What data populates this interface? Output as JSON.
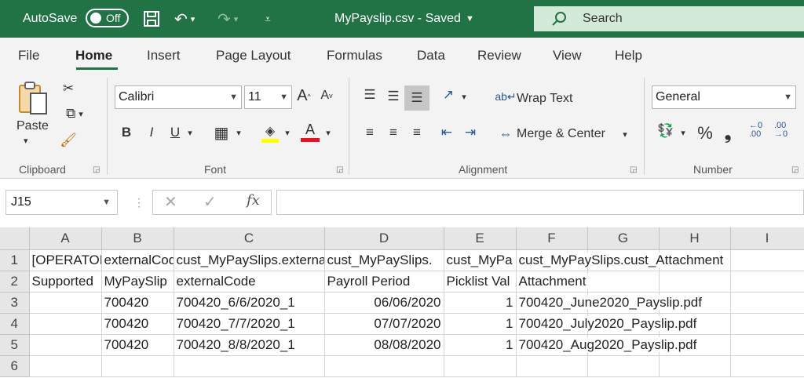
{
  "titlebar": {
    "autosave_label": "AutoSave",
    "autosave_state": "Off",
    "doc_title": "MyPayslip.csv  -  Saved",
    "search_placeholder": "Search"
  },
  "tabs": [
    "File",
    "Home",
    "Insert",
    "Page Layout",
    "Formulas",
    "Data",
    "Review",
    "View",
    "Help"
  ],
  "active_tab": "Home",
  "ribbon": {
    "clipboard": {
      "label": "Clipboard",
      "paste": "Paste"
    },
    "font": {
      "label": "Font",
      "family": "Calibri",
      "size": "11",
      "bold": "B",
      "italic": "I",
      "underline": "U",
      "grow": "A",
      "shrink": "A",
      "font_color_glyph": "A",
      "font_color": "#e81123",
      "highlight_color": "#ffff00"
    },
    "alignment": {
      "label": "Alignment",
      "wrap_text": "Wrap Text",
      "merge_center": "Merge & Center"
    },
    "number": {
      "label": "Number",
      "format": "General",
      "percent": "%",
      "comma": "❟",
      "inc_decimal": "←0 .00",
      "dec_decimal": ".00 →0"
    }
  },
  "formula_bar": {
    "name_box": "J15",
    "fx": "fx",
    "formula": ""
  },
  "grid": {
    "columns": [
      "A",
      "B",
      "C",
      "D",
      "E",
      "F",
      "G",
      "H",
      "I"
    ],
    "rows": [
      {
        "num": "1",
        "cells": [
          "[OPERATOR]",
          "externalCode",
          "cust_MyPaySlips.externalCode",
          "cust_MyPaySlips.",
          "cust_MyPa",
          "cust_MyPaySlips.cust_Attachment",
          "",
          "",
          ""
        ]
      },
      {
        "num": "2",
        "cells": [
          "Supported",
          "MyPaySlip",
          "externalCode",
          "Payroll Period",
          "Picklist Val",
          "Attachment",
          "",
          "",
          ""
        ]
      },
      {
        "num": "3",
        "cells": [
          "",
          "700420",
          "700420_6/6/2020_1",
          "06/06/2020",
          "1",
          "700420_June2020_Payslip.pdf",
          "",
          "",
          ""
        ]
      },
      {
        "num": "4",
        "cells": [
          "",
          "700420",
          "700420_7/7/2020_1",
          "07/07/2020",
          "1",
          "700420_July2020_Payslip.pdf",
          "",
          "",
          ""
        ]
      },
      {
        "num": "5",
        "cells": [
          "",
          "700420",
          "700420_8/8/2020_1",
          "08/08/2020",
          "1",
          "700420_Aug2020_Payslip.pdf",
          "",
          "",
          ""
        ]
      },
      {
        "num": "6",
        "cells": [
          "",
          "",
          "",
          "",
          "",
          "",
          "",
          "",
          ""
        ]
      }
    ]
  },
  "colors": {
    "brand": "#217346",
    "search_bg": "#d3ead9",
    "ribbon_bg": "#f3f3f3"
  }
}
